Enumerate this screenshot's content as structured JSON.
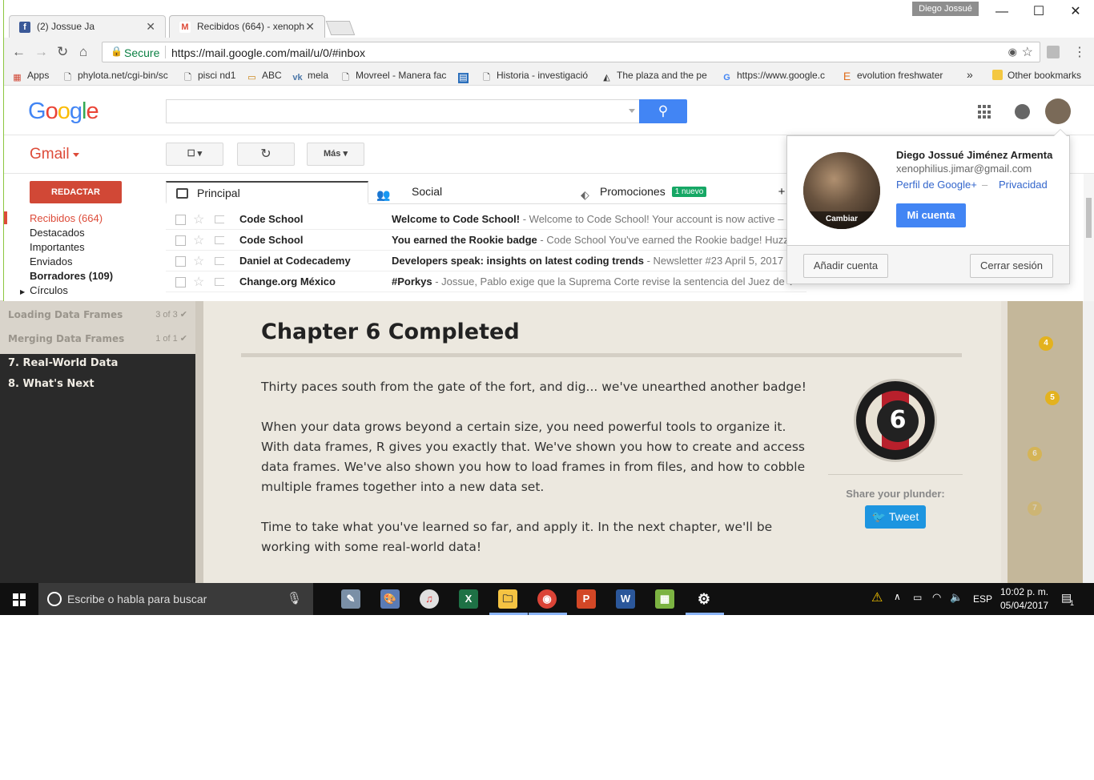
{
  "codeschool": {
    "lessons": [
      {
        "label": "Loading Data Frames",
        "count": "3 of 3 ✔"
      },
      {
        "label": "Merging Data Frames",
        "count": "1 of 1 ✔"
      }
    ],
    "chapters": [
      "7. Real-World Data",
      "8. What's Next"
    ],
    "title": "Chapter 6 Completed",
    "paragraphs": [
      "Thirty paces south from the gate of the fort, and dig... we've unearthed another badge!",
      "When your data grows beyond a certain size, you need powerful tools to organize it. With data frames, R gives you exactly that. We've shown you how to create and access data frames. We've also shown you how to load frames in from files, and how to cobble multiple frames together into a new data set.",
      "Time to take what you've learned so far, and apply it. In the next chapter, we'll be working with some real-world data!"
    ],
    "badge_number": "6",
    "share_label": "Share your plunder:",
    "tweet_label": "Tweet",
    "map_points": [
      "4",
      "5",
      "6",
      "7"
    ]
  },
  "chrome": {
    "user": "Diego Jossué",
    "tabs": [
      {
        "title": "(2) Jossue Ja",
        "icon": "facebook-icon",
        "color": "#3b5998",
        "glyph": "f"
      },
      {
        "title": "Recibidos (664) - xenoph",
        "icon": "gmail-icon",
        "color": "#dd4b39",
        "glyph": "M"
      }
    ],
    "secure_label": "Secure",
    "url": "https://mail.google.com/mail/u/0/#inbox",
    "bookmarks": [
      {
        "label": "Apps",
        "icon": "apps-icon"
      },
      {
        "label": "phylota.net/cgi-bin/sc",
        "icon": "page-icon"
      },
      {
        "label": "pisci nd1",
        "icon": "page-icon"
      },
      {
        "label": "ABC",
        "icon": "abc-icon"
      },
      {
        "label": "mela",
        "icon": "vk-icon"
      },
      {
        "label": "Movreel - Manera fac",
        "icon": "page-icon"
      },
      {
        "label": "",
        "icon": "blue-icon"
      },
      {
        "label": "Historia - investigació",
        "icon": "page-icon"
      },
      {
        "label": "The plaza and the pe",
        "icon": "triangle-icon"
      },
      {
        "label": "https://www.google.c",
        "icon": "google-icon"
      },
      {
        "label": "evolution freshwater",
        "icon": "e-icon"
      }
    ],
    "more_bookmarks": "»",
    "other_bookmarks": "Other bookmarks"
  },
  "gmail": {
    "logo": "Google",
    "app_label": "Gmail",
    "more_label": "Más",
    "compose_label": "REDACTAR",
    "folders": [
      {
        "label": "Recibidos (664)",
        "active": true,
        "bold": false
      },
      {
        "label": "Destacados",
        "active": false,
        "bold": false
      },
      {
        "label": "Importantes",
        "active": false,
        "bold": false
      },
      {
        "label": "Enviados",
        "active": false,
        "bold": false
      },
      {
        "label": "Borradores (109)",
        "active": false,
        "bold": true
      },
      {
        "label": "Círculos",
        "active": false,
        "bold": false
      }
    ],
    "tabs": [
      {
        "label": "Principal"
      },
      {
        "label": "Social"
      },
      {
        "label": "Promociones",
        "badge": "1 nuevo"
      }
    ],
    "add_tab": "+",
    "messages": [
      {
        "from": "Code School",
        "subject": "Welcome to Code School!",
        "snippet": " - Welcome to Code School! Your account is now active – w"
      },
      {
        "from": "Code School",
        "subject": "You earned the Rookie badge",
        "snippet": " - Code School You've earned the Rookie badge! Huzz"
      },
      {
        "from": "Daniel at Codecademy",
        "subject": "Developers speak: insights on latest coding trends",
        "snippet": " - Newsletter #23 April 5, 2017"
      },
      {
        "from": "Change.org México",
        "subject": "#Porkys",
        "snippet": " - Jossue, Pablo exige que la Suprema Corte revise la sentencia del Juez de V"
      }
    ],
    "account": {
      "name": "Diego Jossué Jiménez Armenta",
      "email": "xenophilius.jimar@gmail.com",
      "profile_link": "Perfil de Google+",
      "separator": "–",
      "privacy_link": "Privacidad",
      "account_button": "Mi cuenta",
      "change_label": "Cambiar",
      "add_account": "Añadir cuenta",
      "sign_out": "Cerrar sesión"
    }
  },
  "taskbar": {
    "search_placeholder": "Escribe o habla para buscar",
    "language": "ESP",
    "time": "10:02 p. m.",
    "date": "05/04/2017",
    "notification_count": "1"
  }
}
